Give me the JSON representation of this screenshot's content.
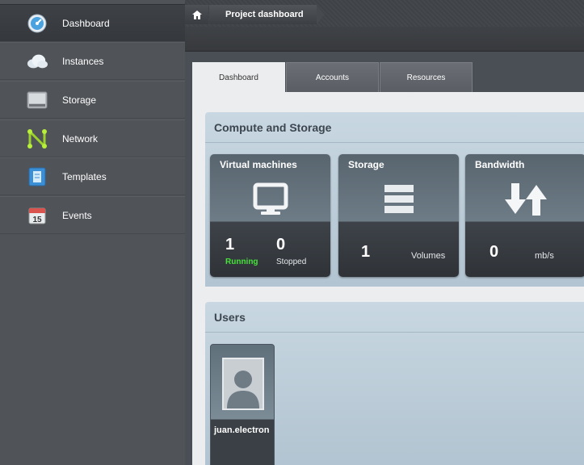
{
  "sidebar": {
    "items": [
      {
        "label": "Dashboard",
        "icon": "dashboard-gauge-icon",
        "active": true
      },
      {
        "label": "Instances",
        "icon": "cloud-icon"
      },
      {
        "label": "Storage",
        "icon": "disk-icon"
      },
      {
        "label": "Network",
        "icon": "network-icon"
      },
      {
        "label": "Templates",
        "icon": "template-icon"
      },
      {
        "label": "Events",
        "icon": "calendar-icon",
        "badge": "15"
      }
    ]
  },
  "breadcrumb": {
    "home_icon": "home-icon",
    "current": "Project dashboard"
  },
  "tabs": [
    {
      "label": "Dashboard",
      "active": true
    },
    {
      "label": "Accounts"
    },
    {
      "label": "Resources"
    }
  ],
  "compute": {
    "title": "Compute and Storage",
    "vm": {
      "title": "Virtual machines",
      "running": "1",
      "running_label": "Running",
      "stopped": "0",
      "stopped_label": "Stopped"
    },
    "storage": {
      "title": "Storage",
      "count": "1",
      "unit": "Volumes"
    },
    "bandwidth": {
      "title": "Bandwidth",
      "value": "0",
      "unit": "mb/s"
    }
  },
  "users": {
    "title": "Users",
    "list": [
      {
        "name": "juan.electron"
      }
    ]
  },
  "colors": {
    "running": "#46e23a",
    "panel": "#ecedef",
    "section": "#c8d7e1"
  }
}
